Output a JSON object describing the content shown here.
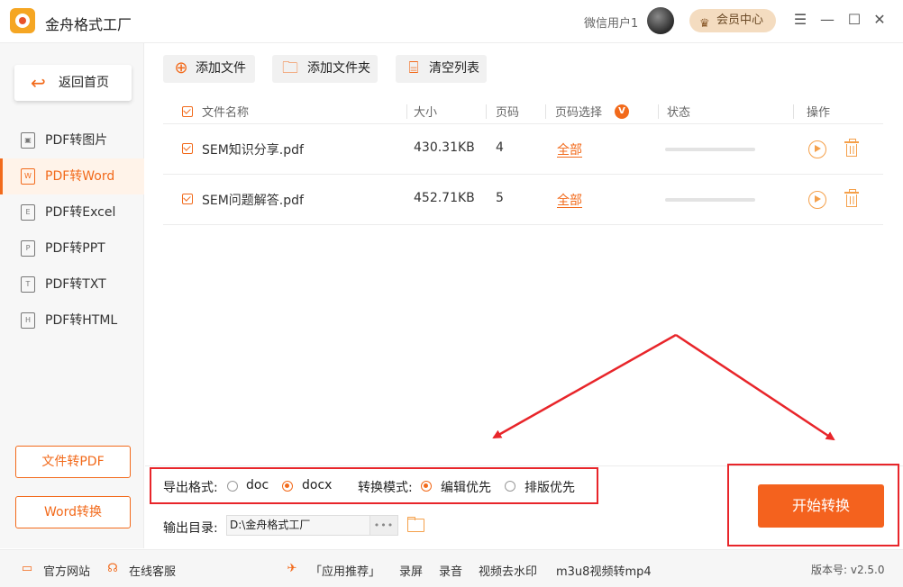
{
  "header": {
    "app_title": "金舟格式工厂",
    "user_name": "微信用户1",
    "vip_label": "会员中心",
    "controls": [
      "☰",
      "—",
      "☐",
      "✕"
    ]
  },
  "sidebar": {
    "back_label": "返回首页",
    "items": [
      {
        "label": "PDF转图片",
        "icon": "image-file-icon",
        "glyph": "▣"
      },
      {
        "label": "PDF转Word",
        "icon": "word-file-icon",
        "glyph": "W"
      },
      {
        "label": "PDF转Excel",
        "icon": "excel-file-icon",
        "glyph": "E"
      },
      {
        "label": "PDF转PPT",
        "icon": "ppt-file-icon",
        "glyph": "P"
      },
      {
        "label": "PDF转TXT",
        "icon": "txt-file-icon",
        "glyph": "T"
      },
      {
        "label": "PDF转HTML",
        "icon": "html-file-icon",
        "glyph": "H"
      }
    ],
    "active_index": 1,
    "bottom_buttons": [
      "文件转PDF",
      "Word转换"
    ]
  },
  "toolbar": {
    "add_file": "添加文件",
    "add_folder": "添加文件夹",
    "clear_list": "清空列表"
  },
  "table": {
    "columns": {
      "name": "文件名称",
      "size": "大小",
      "pages": "页码",
      "page_select": "页码选择",
      "status": "状态",
      "actions": "操作"
    },
    "page_select_badge": "V",
    "rows": [
      {
        "name": "SEM知识分享.pdf",
        "size": "430.31KB",
        "pages": "4",
        "page_select": "全部",
        "progress": 0
      },
      {
        "name": "SEM问题解答.pdf",
        "size": "452.71KB",
        "pages": "5",
        "page_select": "全部",
        "progress": 0
      }
    ]
  },
  "settings": {
    "export_format_label": "导出格式:",
    "format_doc": "doc",
    "format_docx": "docx",
    "selected_format": "docx",
    "mode_label": "转换模式:",
    "mode_edit": "编辑优先",
    "mode_layout": "排版优先",
    "selected_mode": "编辑优先",
    "output_dir_label": "输出目录:",
    "output_dir": "D:\\金舟格式工厂",
    "browse_label": "•••"
  },
  "start_button": "开始转换",
  "footer": {
    "website": "官方网站",
    "service": "在线客服",
    "recommend": "「应用推荐」",
    "links": [
      "录屏",
      "录音",
      "视频去水印",
      "m3u8视频转mp4"
    ],
    "version": "版本号: v2.5.0"
  },
  "colors": {
    "accent": "#f26a1b",
    "annotation": "#e8252a"
  }
}
